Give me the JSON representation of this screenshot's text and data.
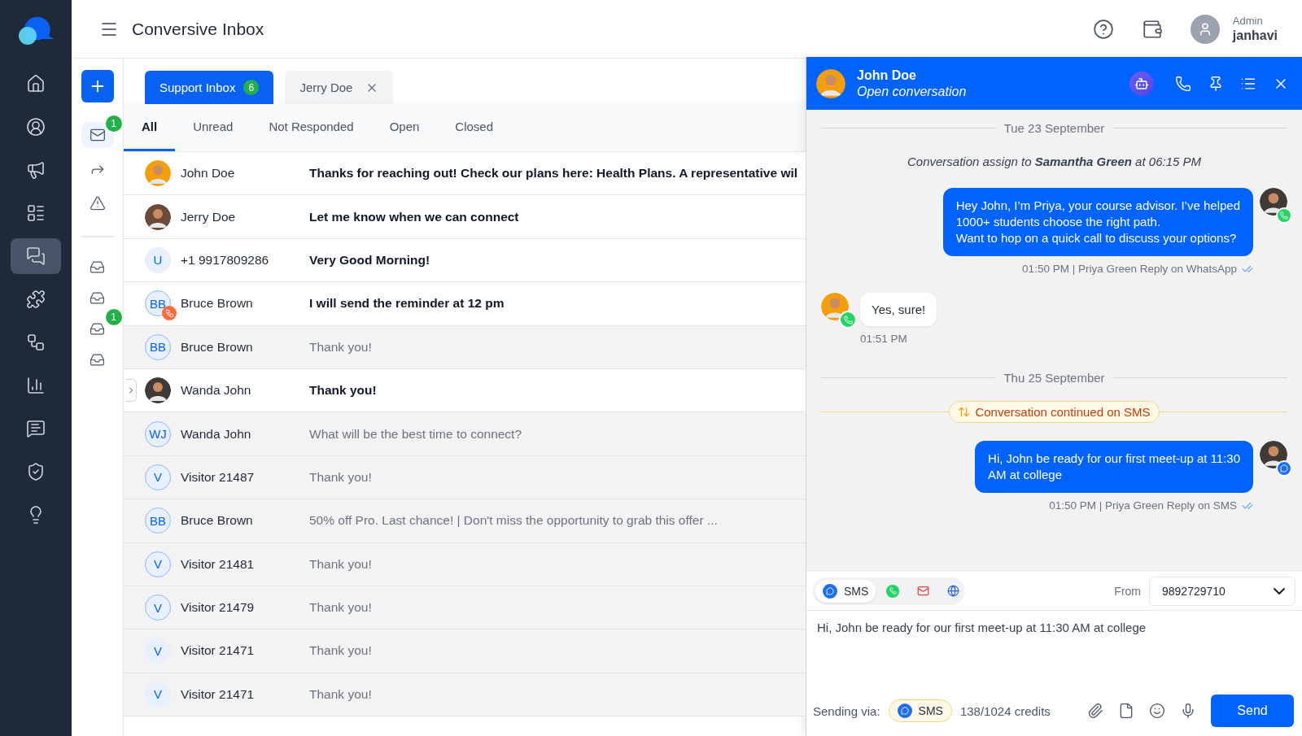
{
  "app": {
    "title": "Conversive Inbox",
    "user": {
      "role": "Admin",
      "name": "janhavi"
    }
  },
  "nav": [
    {
      "selected": false
    },
    {
      "selected": false
    },
    {
      "selected": false
    },
    {
      "selected": false
    },
    {
      "selected": true
    },
    {
      "selected": false
    },
    {
      "selected": false
    },
    {
      "selected": false
    },
    {
      "selected": false
    },
    {
      "selected": false
    },
    {
      "selected": false
    }
  ],
  "sub_sidebar": {
    "items": [
      {
        "selected": true,
        "badge": "1"
      },
      {
        "selected": false
      },
      {
        "selected": false
      }
    ],
    "inboxes": [
      {
        "selected": false
      },
      {
        "selected": false
      },
      {
        "selected": false,
        "badge": "1"
      },
      {
        "selected": false
      }
    ]
  },
  "inbox_tabs": [
    {
      "label": "Support Inbox",
      "count": "6",
      "selected": true,
      "closable": false
    },
    {
      "label": "Jerry Doe",
      "selected": false,
      "closable": true
    }
  ],
  "filters": [
    {
      "label": "All",
      "selected": true
    },
    {
      "label": "Unread",
      "selected": false
    },
    {
      "label": "Not Responded",
      "selected": false
    },
    {
      "label": "Open",
      "selected": false
    },
    {
      "label": "Closed",
      "selected": false
    }
  ],
  "conversations": [
    {
      "name": "John Doe",
      "message": "Thanks for reaching out! Check our plans here: Health Plans. A representative wil",
      "unread": true,
      "avatar": {
        "kind": "photo",
        "color": "#f59e0b"
      }
    },
    {
      "name": "Jerry Doe",
      "message": "Let me know when we can connect",
      "unread": true,
      "avatar": {
        "kind": "photo",
        "color": "#6b4a3a"
      }
    },
    {
      "name": "+1 9917809286",
      "message": "Very Good Morning!",
      "unread": true,
      "avatar": {
        "kind": "initials",
        "text": "U",
        "outlined": false
      }
    },
    {
      "name": "Bruce Brown",
      "message": "I will send the reminder at 12 pm",
      "unread": true,
      "avatar": {
        "kind": "initials",
        "text": "BB",
        "outlined": true,
        "hubspot": true
      }
    },
    {
      "name": "Bruce Brown",
      "message": "Thank you!",
      "unread": false,
      "avatar": {
        "kind": "initials",
        "text": "BB",
        "outlined": true
      }
    },
    {
      "name": "Wanda John",
      "message": "Thank you!",
      "unread": true,
      "handle": true,
      "avatar": {
        "kind": "photo",
        "color": "#3f3a36"
      }
    },
    {
      "name": "Wanda John",
      "message": "What will be the best time to connect?",
      "unread": false,
      "avatar": {
        "kind": "initials",
        "text": "WJ",
        "outlined": true
      }
    },
    {
      "name": "Visitor 21487",
      "message": "Thank you!",
      "unread": false,
      "avatar": {
        "kind": "initials",
        "text": "V",
        "outlined": true
      }
    },
    {
      "name": "Bruce Brown",
      "message": "50% off Pro. Last chance! | Don't miss the opportunity to grab this offer ...",
      "unread": false,
      "avatar": {
        "kind": "initials",
        "text": "BB",
        "outlined": true
      }
    },
    {
      "name": "Visitor 21481",
      "message": "Thank you!",
      "unread": false,
      "avatar": {
        "kind": "initials",
        "text": "V",
        "outlined": true
      }
    },
    {
      "name": "Visitor 21479",
      "message": "Thank you!",
      "unread": false,
      "avatar": {
        "kind": "initials",
        "text": "V",
        "outlined": true
      }
    },
    {
      "name": "Visitor 21471",
      "message": "Thank you!",
      "unread": false,
      "avatar": {
        "kind": "initials",
        "text": "V",
        "outlined": false
      }
    },
    {
      "name": "Visitor 21471",
      "message": "Thank you!",
      "unread": false,
      "avatar": {
        "kind": "initials",
        "text": "V",
        "outlined": false
      }
    }
  ],
  "chat": {
    "name": "John Doe",
    "status": "Open conversation",
    "messages": [
      {
        "kind": "date",
        "text": "Tue 23 September"
      },
      {
        "kind": "system",
        "text": "Conversation assign to **Samantha Green** at 06:15 PM"
      },
      {
        "kind": "outgoing",
        "text": "Hey John, I’m Priya, your course advisor. I’ve helped\n1000+ students choose the right path.\nWant to hop on a quick call to discuss your options?",
        "meta": "01:50 PM | Priya Green Reply on WhatsApp",
        "badge": {
          "kind": "whatsapp"
        },
        "read": true
      },
      {
        "kind": "incoming",
        "text": "Yes, sure!",
        "meta": "01:51 PM",
        "badge": {
          "kind": "whatsapp"
        }
      },
      {
        "kind": "date",
        "text": "Thu 25 September"
      },
      {
        "kind": "notice",
        "text": "Conversation continued on SMS"
      },
      {
        "kind": "outgoing",
        "text": "Hi, John be ready for our first meet-up at 11:30\nAM at college",
        "meta": "01:50 PM | Priya Green Reply on SMS",
        "badge": {
          "kind": "sms"
        },
        "read": true
      }
    ],
    "channels": [
      {
        "kind": "sms",
        "label": "SMS",
        "selected": true
      },
      {
        "kind": "whatsapp",
        "selected": false
      },
      {
        "kind": "email",
        "selected": false
      },
      {
        "kind": "web",
        "selected": false
      }
    ],
    "from": {
      "label": "From",
      "value": "9892729710"
    },
    "draft": "Hi, John be ready for our first meet-up at 11:30 AM at college",
    "sending_via": {
      "label": "Sending via:",
      "channel": "SMS"
    },
    "credits": "138/1024 credits",
    "send": "Send"
  }
}
